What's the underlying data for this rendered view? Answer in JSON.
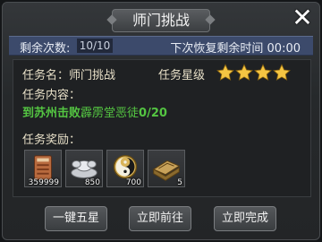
{
  "dialog": {
    "title": "师门挑战",
    "close_glyph": "✕"
  },
  "info_bar": {
    "remaining_label": "剩余次数:",
    "remaining_value": "10/10",
    "recovery_label": "下次恢复剩余时间 00:00"
  },
  "task": {
    "name_label": "任务名：师门挑战",
    "star_label": "任务星级",
    "star_rating": 4,
    "star_max": 4,
    "content_label": "任务内容：",
    "content_prefix": "到苏州击败",
    "content_target": "霹雳堂恶徒",
    "content_progress": "0/20",
    "reward_label": "任务奖励："
  },
  "rewards": [
    {
      "icon": "book-icon",
      "quantity": "359999"
    },
    {
      "icon": "silver-ingot-icon",
      "quantity": "850"
    },
    {
      "icon": "yin-yang-icon",
      "quantity": "700"
    },
    {
      "icon": "scroll-chest-icon",
      "quantity": "5"
    }
  ],
  "buttons": {
    "five_star": "一键五星",
    "go_now": "立即前往",
    "complete_now": "立即完成"
  },
  "colors": {
    "accent_green": "#54c542",
    "star_gold": "#f5c542",
    "info_bar_blue": "#3c4a6b"
  }
}
